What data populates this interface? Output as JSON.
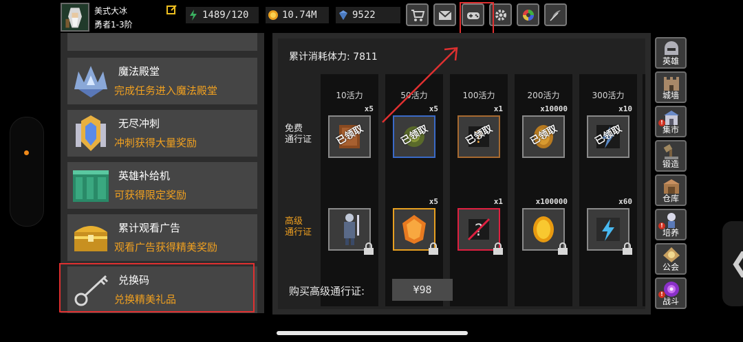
{
  "player": {
    "name": "美式大冰",
    "rank": "勇者1-3阶"
  },
  "stats": [
    {
      "icon": "energy-icon",
      "value": "1489/120"
    },
    {
      "icon": "gold-coin-icon",
      "value": "10.74M"
    },
    {
      "icon": "diamond-icon",
      "value": "9522"
    }
  ],
  "top_buttons": [
    "shop-cart-icon",
    "mail-icon",
    "gamepad-icon",
    "settings-gear-icon",
    "color-wheel-icon",
    "feather-icon"
  ],
  "left_entries": [
    {
      "title": "魔法殿堂",
      "subtitle": "完成任务进入魔法殿堂",
      "icon": "crystal-crown-icon"
    },
    {
      "title": "无尽冲刺",
      "subtitle": "冲刺获得大量奖励",
      "icon": "gem-shield-icon"
    },
    {
      "title": "英雄补给机",
      "subtitle": "可获得限定奖励",
      "icon": "supply-machine-icon"
    },
    {
      "title": "累计观看广告",
      "subtitle": "观看广告获得精美奖励",
      "icon": "treasure-chest-icon"
    },
    {
      "title": "兑换码",
      "subtitle": "兑换精美礼品",
      "icon": "key-icon"
    }
  ],
  "pass": {
    "consumed_label": "累计消耗体力: 7811",
    "free_label": "免费\n通行证",
    "premium_label": "高级\n通行证",
    "claimed_text": "已领取",
    "columns": [
      {
        "header": "10活力",
        "free_qty": "x5",
        "premium_qty": ""
      },
      {
        "header": "50活力",
        "free_qty": "x5",
        "premium_qty": "x5"
      },
      {
        "header": "100活力",
        "free_qty": "x1",
        "premium_qty": "x1"
      },
      {
        "header": "200活力",
        "free_qty": "x10000",
        "premium_qty": "x100000"
      },
      {
        "header": "300活力",
        "free_qty": "x10",
        "premium_qty": "x60"
      }
    ],
    "buy_label": "购买高级通行证:",
    "price": "¥98"
  },
  "sidebar": [
    {
      "label": "英雄",
      "icon": "helmet-icon",
      "alert": false
    },
    {
      "label": "城墙",
      "icon": "wall-icon",
      "alert": false
    },
    {
      "label": "集市",
      "icon": "market-icon",
      "alert": true
    },
    {
      "label": "锻造",
      "icon": "anvil-icon",
      "alert": false
    },
    {
      "label": "仓库",
      "icon": "warehouse-icon",
      "alert": false
    },
    {
      "label": "培养",
      "icon": "training-icon",
      "alert": true
    },
    {
      "label": "公会",
      "icon": "guild-icon",
      "alert": false
    },
    {
      "label": "战斗",
      "icon": "battle-portal-icon",
      "alert": true
    }
  ],
  "colors": {
    "accent_orange": "#f0a020",
    "highlight_red": "#e03030"
  }
}
